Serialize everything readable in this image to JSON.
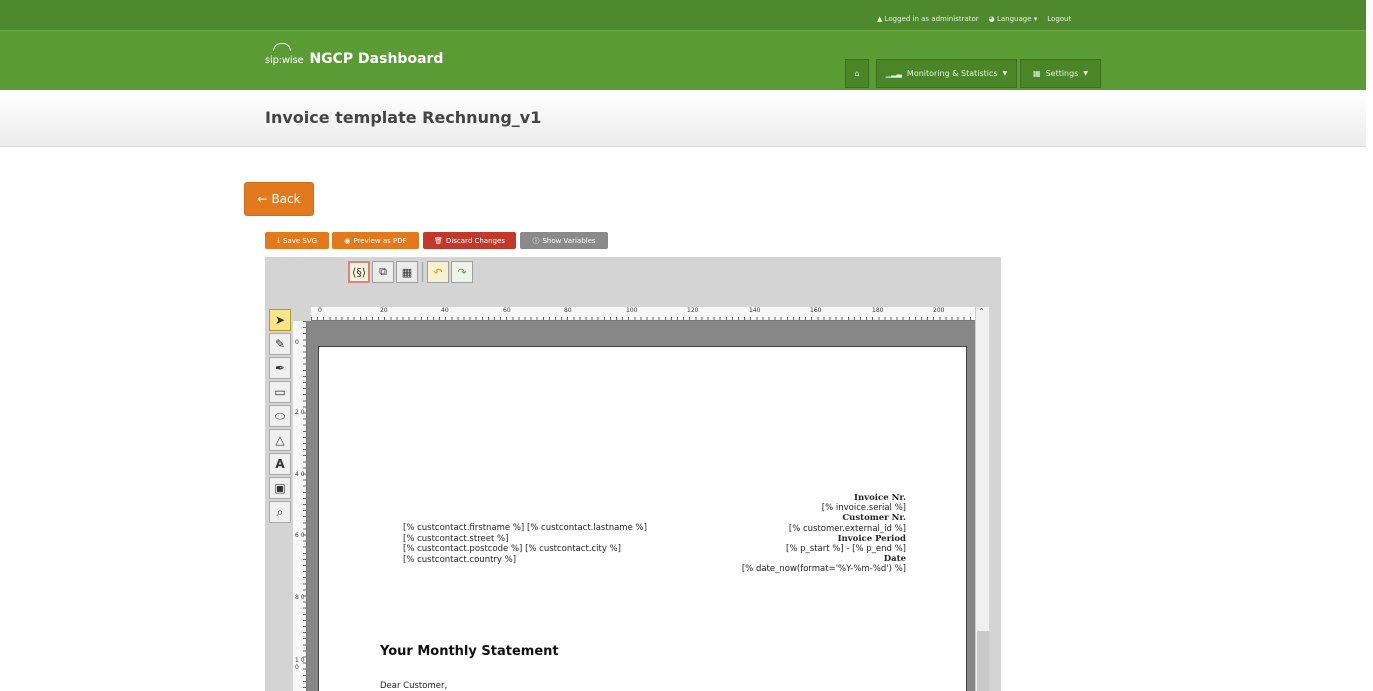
{
  "topbar": {
    "logged_in": "▲ Logged in as administrator",
    "language": "◕ Language ▾",
    "logout": "Logout"
  },
  "brand": {
    "logo_text": "sip:wise",
    "title": "NGCP Dashboard"
  },
  "nav": {
    "home_icon": "home-icon",
    "monitoring": "Monitoring & Statistics",
    "settings": "Settings"
  },
  "page": {
    "title": "Invoice template Rechnung_v1"
  },
  "back_label": "Back",
  "toolbar": {
    "save_svg": "Save SVG",
    "preview_pdf": "Preview as PDF",
    "discard": "Discard Changes",
    "show_vars": "Show Variables",
    "colors": {
      "orange": "#e27a1d",
      "red": "#c0392b",
      "gray": "#8a8a8a"
    }
  },
  "ruler": {
    "h_labels": [
      "0",
      "20",
      "40",
      "60",
      "80",
      "100",
      "120",
      "140",
      "160",
      "180",
      "200"
    ],
    "v_labels": [
      "0",
      "2 0",
      "4 0",
      "6 0",
      "8 0",
      "1 0 0"
    ]
  },
  "invoice": {
    "address_lines": [
      "[% custcontact.firstname %] [% custcontact.lastname %]",
      "[% custcontact.street %]",
      "[% custcontact.postcode %] [% custcontact.city %]",
      "[% custcontact.country %]"
    ],
    "invoice_nr_label": "Invoice Nr.",
    "invoice_nr_value": "[% invoice.serial %]",
    "customer_nr_label": "Customer Nr.",
    "customer_nr_value": "[% customer.external_id %]",
    "period_label": "Invoice Period",
    "period_value": "[% p_start %] - [% p_end %]",
    "date_label": "Date",
    "date_value": "[% date_now(format='%Y-%m-%d') %]",
    "statement_title": "Your Monthly Statement",
    "greeting": "Dear Customer,"
  }
}
